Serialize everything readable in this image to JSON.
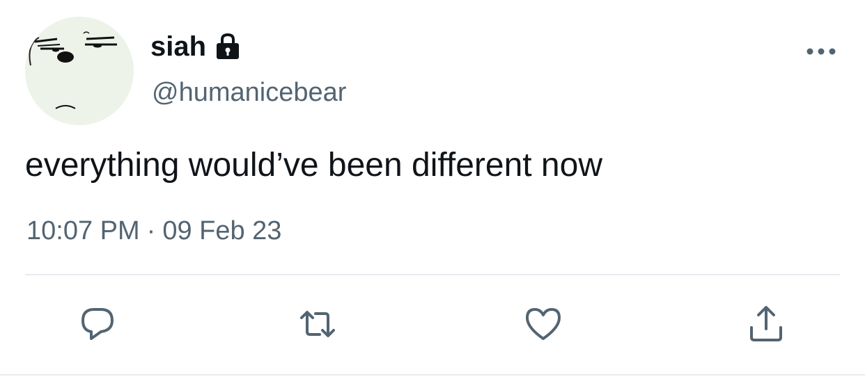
{
  "tweet": {
    "display_name": "siah",
    "handle": "@humanicebear",
    "text": "everything would’ve been different now",
    "time": "10:07 PM",
    "separator": "·",
    "date": "09 Feb 23",
    "protected": true
  },
  "icons": {
    "lock": "lock-icon",
    "more": "more-icon",
    "reply": "reply-icon",
    "retweet": "retweet-icon",
    "like": "heart-icon",
    "share": "share-icon"
  },
  "colors": {
    "primary_text": "#0f1419",
    "secondary_text": "#536471",
    "icon_gray": "#536471",
    "divider": "#e7ebee",
    "background": "#ffffff"
  }
}
